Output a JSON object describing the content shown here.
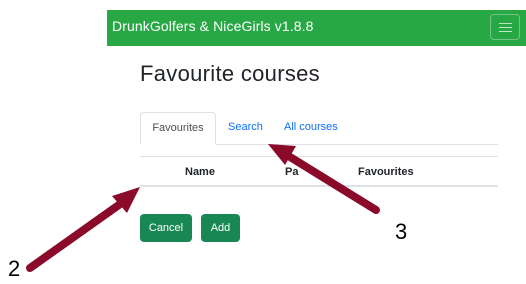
{
  "navbar": {
    "brand": "DrunkGolfers & NiceGirls v1.8.8",
    "menu_icon": "hamburger-icon",
    "color": "#28a745"
  },
  "page": {
    "title": "Favourite courses"
  },
  "tabs": [
    {
      "label": "Favourites",
      "active": true
    },
    {
      "label": "Search",
      "active": false
    },
    {
      "label": "All courses",
      "active": false
    }
  ],
  "table": {
    "columns": [
      "Name",
      "Pa",
      "Favourites"
    ]
  },
  "buttons": {
    "cancel_label": "Cancel",
    "add_label": "Add",
    "color": "#198754"
  },
  "annotations": {
    "label_2": "2",
    "label_3": "3",
    "arrow_color": "#8b0a2a"
  }
}
